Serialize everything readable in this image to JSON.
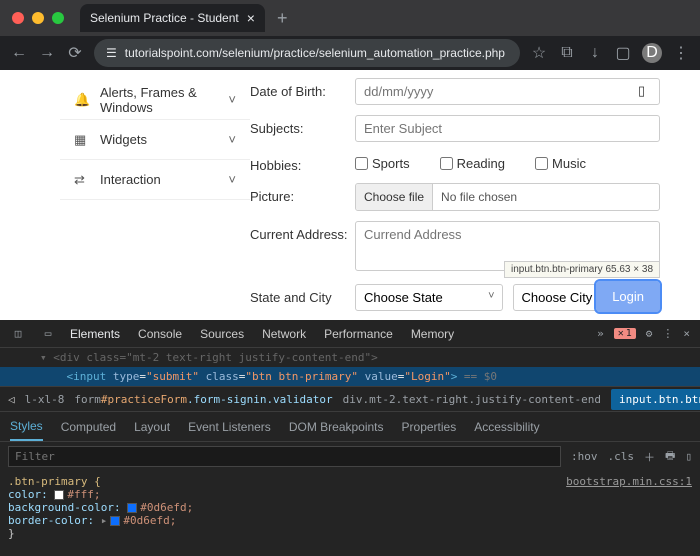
{
  "browser": {
    "tab_title": "Selenium Practice - Student",
    "url": "tutorialspoint.com/selenium/practice/selenium_automation_practice.php",
    "icons": {
      "star": "☆",
      "ext": "⧉",
      "dl": "↓",
      "box": "▢",
      "avatar": "D"
    }
  },
  "sidebar": {
    "items": [
      {
        "icon": "bell",
        "label": "Alerts, Frames & Windows"
      },
      {
        "icon": "grid",
        "label": "Widgets"
      },
      {
        "icon": "swap",
        "label": "Interaction"
      }
    ]
  },
  "form": {
    "dob_label": "Date of Birth:",
    "dob_placeholder": "dd/mm/yyyy",
    "subjects_label": "Subjects:",
    "subjects_placeholder": "Enter Subject",
    "hobbies_label": "Hobbies:",
    "hobbies": {
      "sports": "Sports",
      "reading": "Reading",
      "music": "Music"
    },
    "picture_label": "Picture:",
    "file_btn": "Choose file",
    "file_text": "No file chosen",
    "addr_label": "Current Address:",
    "addr_placeholder": "Currend Address",
    "state_label": "State and City",
    "state_select": "Choose State",
    "city_select": "Choose City",
    "login": "Login",
    "tooltip": "input.btn.btn-primary   65.63 × 38"
  },
  "devtools": {
    "tabs": [
      "Elements",
      "Console",
      "Sources",
      "Network",
      "Performance",
      "Memory"
    ],
    "errors": "1",
    "code_dim": "<div class=\"mt-2 text-right justify-content-end\">",
    "code_sel_prefix": "<input ",
    "code_attrs": "type=\"submit\" class=\"btn btn-primary\" value=\"Login\">",
    "eq_sel": " == $0",
    "breadcrumb": {
      "one": "l-xl-8",
      "two_pre": "form",
      "two_id": "#practiceForm",
      "two_cls": ".form-signin.validator",
      "three": "div.mt-2.text-right.justify-content-end",
      "active": "input.btn.btn-primary"
    },
    "styles_tabs": [
      "Styles",
      "Computed",
      "Layout",
      "Event Listeners",
      "DOM Breakpoints",
      "Properties",
      "Accessibility"
    ],
    "filter_placeholder": "Filter",
    "hov": ":hov",
    "cls": ".cls",
    "css": {
      "selector": ".btn-primary {",
      "src": "bootstrap.min.css:1",
      "p1": "  color:",
      "v1_hex": "#fff",
      "v1": "#fff;",
      "p2": "  background-color:",
      "v2_hex": "#0d6efd",
      "v2": "#0d6efd;",
      "p3": "  border-color:",
      "v3_hex": "#0d6efd",
      "v3": "#0d6efd;",
      "close": "}"
    }
  }
}
